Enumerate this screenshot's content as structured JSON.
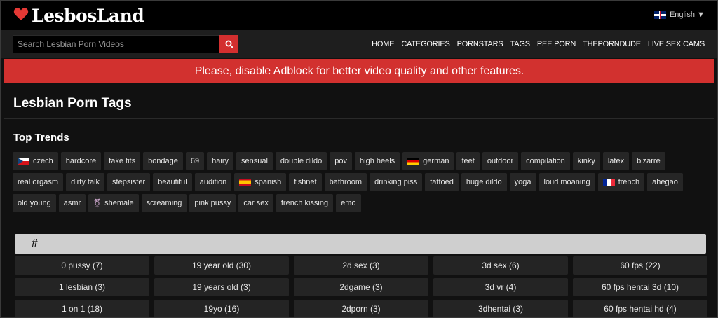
{
  "brand": {
    "name": "LesbosLand",
    "accent": "#d2312f"
  },
  "language": {
    "label": "English ▼",
    "flag": "uk-flag-icon"
  },
  "search": {
    "placeholder": "Search Lesbian Porn Videos",
    "icon": "search-icon"
  },
  "nav": [
    "HOME",
    "CATEGORIES",
    "PORNSTARS",
    "TAGS",
    "PEE PORN",
    "THEPORNDUDE",
    "LIVE SEX CAMS"
  ],
  "banner": {
    "text": "Please, disable Adblock for better video quality and other features."
  },
  "page_title": "Lesbian Porn Tags",
  "top_trends": {
    "title": "Top Trends",
    "tags": [
      {
        "label": "czech",
        "icon": "flag-cz"
      },
      {
        "label": "hardcore"
      },
      {
        "label": "fake tits"
      },
      {
        "label": "bondage"
      },
      {
        "label": "69"
      },
      {
        "label": "hairy"
      },
      {
        "label": "sensual"
      },
      {
        "label": "double dildo"
      },
      {
        "label": "pov"
      },
      {
        "label": "high heels"
      },
      {
        "label": "german",
        "icon": "flag-de"
      },
      {
        "label": "feet"
      },
      {
        "label": "outdoor"
      },
      {
        "label": "compilation"
      },
      {
        "label": "kinky"
      },
      {
        "label": "latex"
      },
      {
        "label": "bizarre"
      },
      {
        "label": "real orgasm"
      },
      {
        "label": "dirty talk"
      },
      {
        "label": "stepsister"
      },
      {
        "label": "beautiful"
      },
      {
        "label": "audition"
      },
      {
        "label": "spanish",
        "icon": "flag-es"
      },
      {
        "label": "fishnet"
      },
      {
        "label": "bathroom"
      },
      {
        "label": "drinking piss"
      },
      {
        "label": "tattoed"
      },
      {
        "label": "huge dildo"
      },
      {
        "label": "yoga"
      },
      {
        "label": "loud moaning"
      },
      {
        "label": "french",
        "icon": "flag-fr"
      },
      {
        "label": "ahegao"
      },
      {
        "label": "old young"
      },
      {
        "label": "asmr"
      },
      {
        "label": "shemale",
        "icon": "transgender-icon"
      },
      {
        "label": "screaming"
      },
      {
        "label": "pink pussy"
      },
      {
        "label": "car sex"
      },
      {
        "label": "french kissing"
      },
      {
        "label": "emo"
      }
    ]
  },
  "letter_section": {
    "letter": "#",
    "items": [
      "0 pussy (7)",
      "19 year old (30)",
      "2d sex (3)",
      "3d sex (6)",
      "60 fps (22)",
      "1 lesbian (3)",
      "19 years old (3)",
      "2dgame (3)",
      "3d vr (4)",
      "60 fps hentai 3d (10)",
      "1 on 1 (18)",
      "19yo (16)",
      "2dporn (3)",
      "3dhentai (3)",
      "60 fps hentai hd (4)"
    ]
  }
}
